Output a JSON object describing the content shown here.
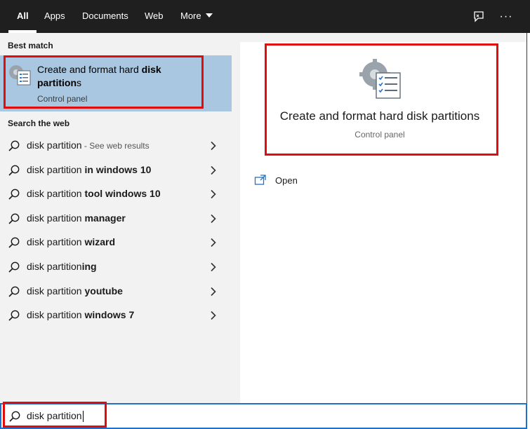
{
  "top_bar": {
    "tabs": [
      {
        "label": "All"
      },
      {
        "label": "Apps"
      },
      {
        "label": "Documents"
      },
      {
        "label": "Web"
      },
      {
        "label": "More"
      }
    ],
    "feedback_icon": "feedback-icon",
    "more_options_label": "···"
  },
  "left_panel": {
    "best_match_label": "Best match",
    "best_match": {
      "title_plain": "Create and format hard ",
      "title_bold_1": "disk",
      "title_bold_2": "partition",
      "title_tail": "s",
      "subtitle": "Control panel",
      "icon": "disk-management-icon"
    },
    "web_label": "Search the web",
    "web_results": [
      {
        "prefix": "disk partition",
        "bold": "",
        "hint": " - See web results"
      },
      {
        "prefix": "disk partition ",
        "bold": "in windows 10",
        "hint": ""
      },
      {
        "prefix": "disk partition ",
        "bold": "tool windows 10",
        "hint": ""
      },
      {
        "prefix": "disk partition ",
        "bold": "manager",
        "hint": ""
      },
      {
        "prefix": "disk partition ",
        "bold": "wizard",
        "hint": ""
      },
      {
        "prefix": "disk partition",
        "bold": "ing",
        "hint": ""
      },
      {
        "prefix": "disk partition ",
        "bold": "youtube",
        "hint": ""
      },
      {
        "prefix": "disk partition ",
        "bold": "windows 7",
        "hint": ""
      }
    ]
  },
  "right_panel": {
    "title": "Create and format hard disk partitions",
    "subtitle": "Control panel",
    "actions": [
      {
        "label": "Open",
        "icon": "open-icon"
      }
    ]
  },
  "search": {
    "value": "disk partition",
    "icon": "search-icon"
  },
  "colors": {
    "topbar": "#1f1f1f",
    "panel": "#f2f2f2",
    "selected": "#a9c7e0",
    "accent": "#1e73c8",
    "highlight": "#e10d0d"
  }
}
